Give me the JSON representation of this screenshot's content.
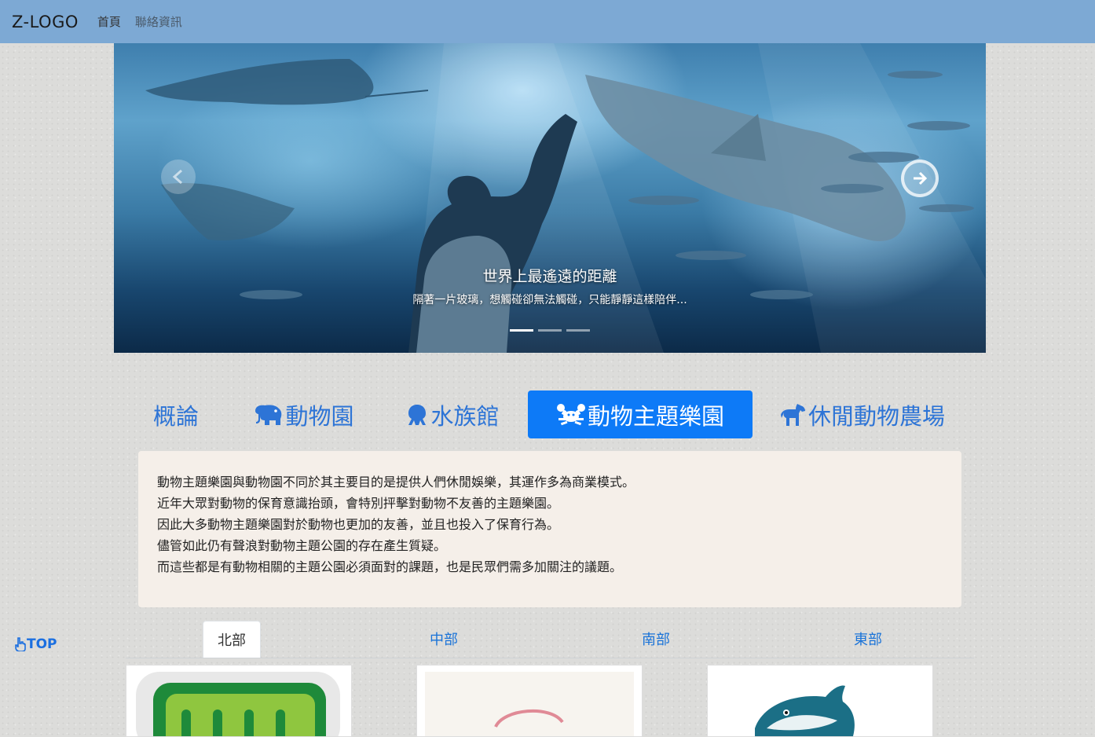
{
  "navbar": {
    "brand": "Z-LOGO",
    "links": [
      "首頁",
      "聯絡資訊"
    ]
  },
  "carousel": {
    "caption_title": "世界上最遙遠的距離",
    "caption_text": "隔著一片玻璃，想觸碰卻無法觸碰，只能靜靜這樣陪伴...",
    "indicator_count": 3,
    "active_index": 0
  },
  "category_tabs": [
    {
      "label": "概論",
      "icon": "",
      "active": false
    },
    {
      "label": "動物園",
      "icon": "elephant-icon",
      "active": false
    },
    {
      "label": "水族館",
      "icon": "octopus-icon",
      "active": false
    },
    {
      "label": "動物主題樂園",
      "icon": "crab-icon",
      "active": true
    },
    {
      "label": "休閒動物農場",
      "icon": "horse-icon",
      "active": false
    }
  ],
  "content": {
    "lines": [
      "動物主題樂園與動物園不同於其主要目的是提供人們休閒娛樂，其運作多為商業模式。",
      "近年大眾對動物的保育意識抬頭，會特別抨擊對動物不友善的主題樂園。",
      "因此大多動物主題樂園對於動物也更加的友善，並且也投入了保育行為。",
      "儘管如此仍有聲浪對動物主題公園的存在產生質疑。",
      "而這些都是有動物相關的主題公園必須面對的課題，也是民眾們需多加關注的議題。"
    ]
  },
  "top_button": {
    "label": "TOP",
    "icon": "hand-point-up-icon"
  },
  "region_tabs": [
    {
      "label": "北部",
      "active": true
    },
    {
      "label": "中部",
      "active": false
    },
    {
      "label": "南部",
      "active": false
    },
    {
      "label": "東部",
      "active": false
    }
  ],
  "colors": {
    "navbar": "#7da9d4",
    "accent": "#0d7af7",
    "tab_text": "#2d74d6",
    "content_bg": "#f5efe9"
  }
}
